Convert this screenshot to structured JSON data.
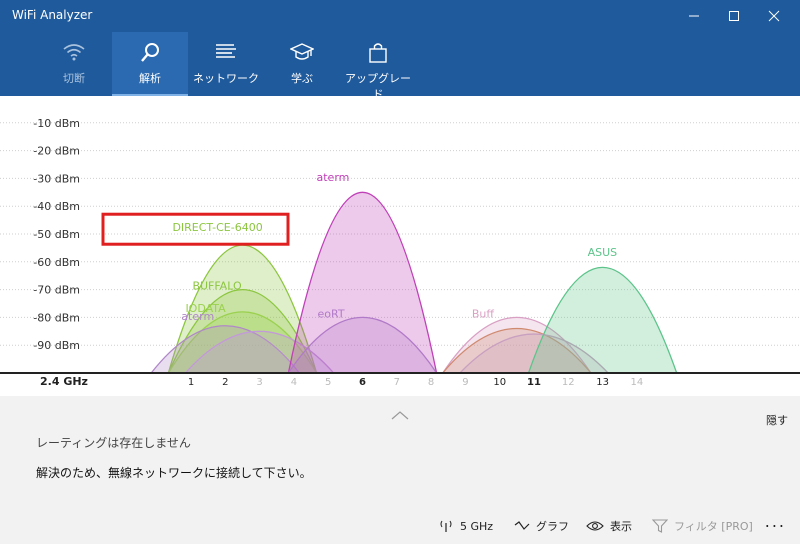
{
  "window": {
    "title": "WiFi Analyzer",
    "controls": [
      "minimize",
      "maximize",
      "close"
    ]
  },
  "nav": [
    {
      "label": "切断",
      "icon": "wifi-icon",
      "active": false,
      "disabled": true
    },
    {
      "label": "解析",
      "icon": "search-icon",
      "active": true,
      "disabled": false
    },
    {
      "label": "ネットワーク",
      "icon": "list-icon",
      "active": false,
      "disabled": false
    },
    {
      "label": "学ぶ",
      "icon": "graduation-cap-icon",
      "active": false,
      "disabled": false
    },
    {
      "label": "アップグレード",
      "icon": "shopping-bag-icon",
      "active": false,
      "disabled": false
    }
  ],
  "chart_data": {
    "type": "area",
    "band_label": "2.4 GHz",
    "ylim": [
      -100,
      -5
    ],
    "y_ticks": [
      {
        "v": -10,
        "label": "-10 dBm"
      },
      {
        "v": -20,
        "label": "-20 dBm"
      },
      {
        "v": -30,
        "label": "-30 dBm"
      },
      {
        "v": -40,
        "label": "-40 dBm"
      },
      {
        "v": -50,
        "label": "-50 dBm"
      },
      {
        "v": -60,
        "label": "-60 dBm"
      },
      {
        "v": -70,
        "label": "-70 dBm"
      },
      {
        "v": -80,
        "label": "-80 dBm"
      },
      {
        "v": -90,
        "label": "-90 dBm"
      }
    ],
    "x_ticks": [
      {
        "v": 1,
        "label": "1",
        "bold": false
      },
      {
        "v": 2,
        "label": "2",
        "bold": false
      },
      {
        "v": 3,
        "label": "3",
        "dim": true
      },
      {
        "v": 4,
        "label": "4",
        "dim": true
      },
      {
        "v": 5,
        "label": "5",
        "dim": true
      },
      {
        "v": 6,
        "label": "6",
        "bold": true
      },
      {
        "v": 7,
        "label": "7",
        "dim": true
      },
      {
        "v": 8,
        "label": "8",
        "dim": true
      },
      {
        "v": 9,
        "label": "9",
        "dim": true
      },
      {
        "v": 10,
        "label": "10",
        "bold": false
      },
      {
        "v": 11,
        "label": "11",
        "bold": true
      },
      {
        "v": 12,
        "label": "12",
        "dim": true
      },
      {
        "v": 13,
        "label": "13",
        "bold": false
      },
      {
        "v": 14,
        "label": "14",
        "dim": true
      }
    ],
    "series": [
      {
        "name": "DIRECT-CE-6400",
        "channel": 2.5,
        "rssi": -54,
        "color": "#8cc63f",
        "label_v": -49
      },
      {
        "name": "BUFFALO",
        "channel": 2.5,
        "rssi": -70,
        "color": "#8cc63f",
        "label_v": -70
      },
      {
        "name": "IODATA",
        "channel": 2.5,
        "rssi": -78,
        "color": "#9bd14f",
        "label_v": -78
      },
      {
        "name": "aterm",
        "channel": 2,
        "rssi": -83,
        "color": "#b088c8",
        "label_v": -81
      },
      {
        "name": "",
        "channel": 3,
        "rssi": -85,
        "color": "#c39ad8",
        "label_v": null
      },
      {
        "name": "aterm",
        "channel": 6,
        "rssi": -35,
        "color": "#c040b8",
        "label_v": -31
      },
      {
        "name": "eoRT",
        "channel": 6,
        "rssi": -80,
        "color": "#b07ac8",
        "label_v": -80
      },
      {
        "name": "Buff",
        "channel": 10.5,
        "rssi": -80,
        "color": "#d9a0c4",
        "label_v": -80
      },
      {
        "name": "",
        "channel": 10.5,
        "rssi": -84,
        "color": "#d08a70",
        "label_v": null
      },
      {
        "name": "",
        "channel": 11,
        "rssi": -86,
        "color": "#c8a0c0",
        "label_v": null
      },
      {
        "name": "ASUS",
        "channel": 13,
        "rssi": -62,
        "color": "#5cc48a",
        "label_v": -58
      }
    ],
    "highlight": "DIRECT-CE-6400"
  },
  "panel": {
    "hide_label": "隠す",
    "rating_text": "レーティングは存在しません",
    "solution_text": "解決のため、無線ネットワークに接続して下さい。"
  },
  "toolbar": {
    "band": "5 GHz",
    "graph": "グラフ",
    "view": "表示",
    "filter": "フィルタ [PRO]",
    "more": "..."
  }
}
